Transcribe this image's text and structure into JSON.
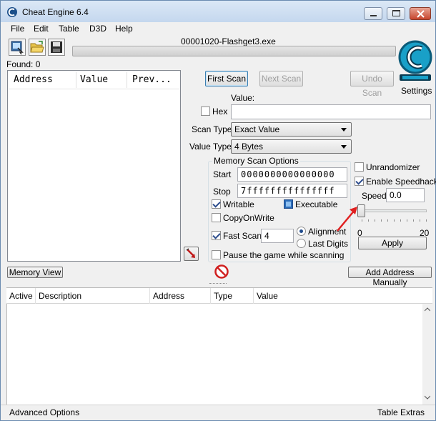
{
  "window": {
    "title": "Cheat Engine 6.4",
    "icon": "cheat-engine-icon"
  },
  "menu": [
    "File",
    "Edit",
    "Table",
    "D3D",
    "Help"
  ],
  "toolbar": {
    "icons": [
      "select-process-icon",
      "open-file-icon",
      "save-icon"
    ]
  },
  "process": {
    "name": "00001020-Flashget3.exe"
  },
  "logo": {
    "icon": "cheat-engine-logo",
    "settings_label": "Settings"
  },
  "results": {
    "found_label": "Found: 0",
    "columns": [
      "Address",
      "Value",
      "Prev..."
    ]
  },
  "scan": {
    "first_scan": "First Scan",
    "next_scan": "Next Scan",
    "undo_scan": "Undo Scan",
    "value_label": "Value:",
    "value_input": "",
    "hex_label": "Hex",
    "hex_checked": false,
    "scan_type_label": "Scan Type",
    "scan_type_value": "Exact Value",
    "value_type_label": "Value Type",
    "value_type_value": "4 Bytes"
  },
  "memory_options": {
    "title": "Memory Scan Options",
    "start_label": "Start",
    "start_value": "0000000000000000",
    "stop_label": "Stop",
    "stop_value": "7fffffffffffffff",
    "writable_label": "Writable",
    "writable_checked": true,
    "executable_label": "Executable",
    "executable_checked": true,
    "copyonwrite_label": "CopyOnWrite",
    "copyonwrite_checked": false,
    "fast_scan_label": "Fast Scan",
    "fast_scan_checked": true,
    "fast_scan_value": "4",
    "alignment_label": "Alignment",
    "alignment_selected": true,
    "last_digits_label": "Last Digits",
    "last_digits_selected": false,
    "pause_label": "Pause the game while scanning",
    "pause_checked": false
  },
  "speedhack": {
    "unrandomizer_label": "Unrandomizer",
    "unrandomizer_checked": false,
    "enable_label": "Enable Speedhack",
    "enable_checked": true,
    "speed_label": "Speed",
    "speed_value": "0.0",
    "slider_min": "0",
    "slider_max": "20",
    "slider_fraction": 0.0,
    "apply_label": "Apply",
    "arrow_color": "#e02020"
  },
  "bottom": {
    "memory_view": "Memory View",
    "add_address": "Add Address Manually",
    "stop_icon": "stop-icon",
    "pointer_icon": "pointer-arrow-icon"
  },
  "address_list": {
    "columns": [
      "Active",
      "Description",
      "Address",
      "Type",
      "Value"
    ]
  },
  "statusbar": {
    "left": "Advanced Options",
    "right": "Table Extras"
  },
  "colors": {
    "title_bar": "#c4d7ee",
    "window_bg": "#f0f0f0",
    "close_button": "#c7452d",
    "stop_icon": "#d02020"
  }
}
